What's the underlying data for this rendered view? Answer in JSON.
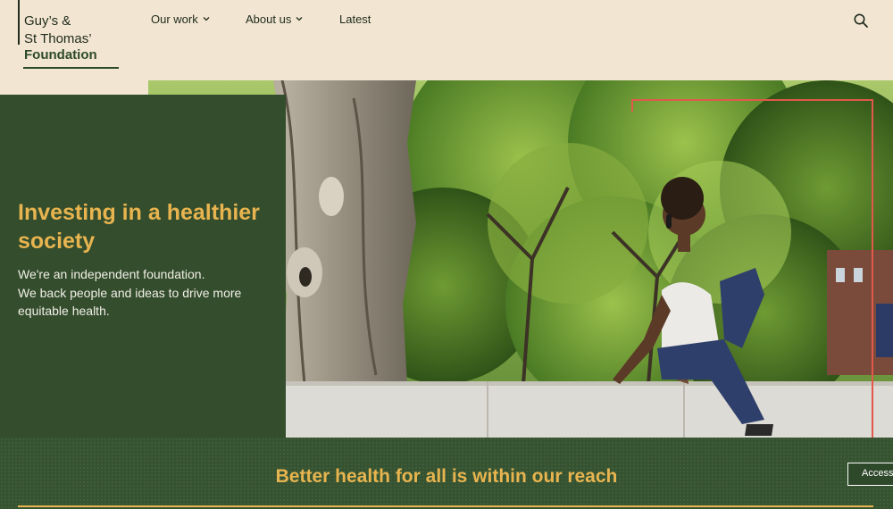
{
  "brand": {
    "line1": "Guy’s &",
    "line2": "St Thomas’",
    "line3": "Foundation"
  },
  "nav": {
    "our_work": "Our work",
    "about_us": "About us",
    "latest": "Latest"
  },
  "hero": {
    "title": "Investing in a healthier society",
    "body_line1": "We're an independent foundation.",
    "body_line2": "We back people and ideas to drive more equitable health."
  },
  "band": {
    "title": "Better health for all is within our reach"
  },
  "accessibility_button": "Access",
  "colors": {
    "header_bg": "#f2e5d2",
    "panel_green": "#334d2d",
    "accent_yellow": "#e8b44f",
    "accent_red": "#e2584b"
  },
  "icons": {
    "search": "search-icon",
    "chevron": "chevron-down-icon"
  }
}
